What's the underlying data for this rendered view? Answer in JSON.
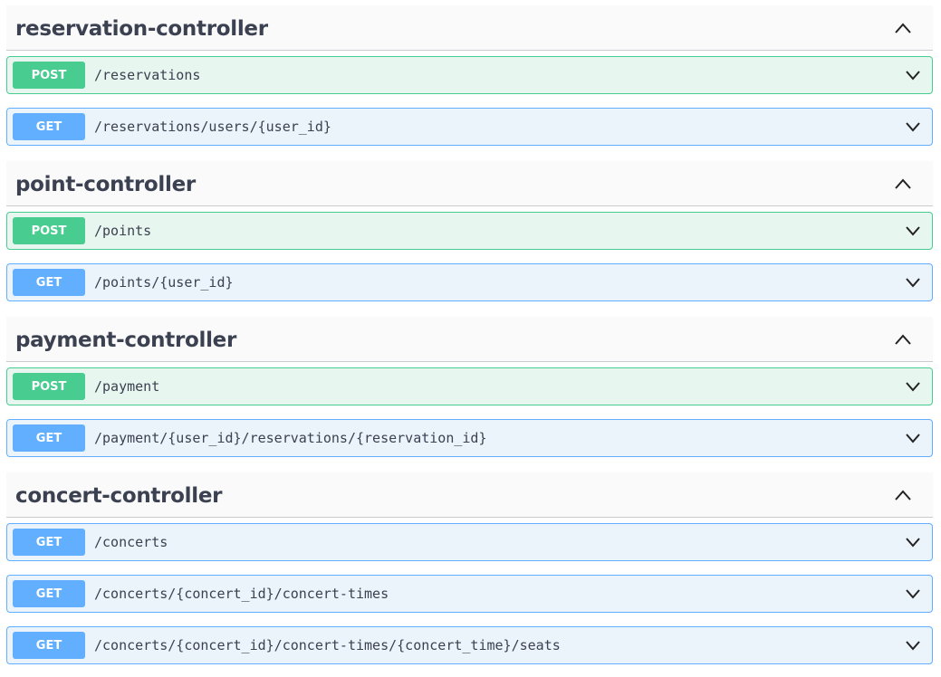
{
  "sections": [
    {
      "title": "reservation-controller",
      "operations": [
        {
          "method": "POST",
          "path": "/reservations"
        },
        {
          "method": "GET",
          "path": "/reservations/users/{user_id}"
        }
      ]
    },
    {
      "title": "point-controller",
      "operations": [
        {
          "method": "POST",
          "path": "/points"
        },
        {
          "method": "GET",
          "path": "/points/{user_id}"
        }
      ]
    },
    {
      "title": "payment-controller",
      "operations": [
        {
          "method": "POST",
          "path": "/payment"
        },
        {
          "method": "GET",
          "path": "/payment/{user_id}/reservations/{reservation_id}"
        }
      ]
    },
    {
      "title": "concert-controller",
      "operations": [
        {
          "method": "GET",
          "path": "/concerts"
        },
        {
          "method": "GET",
          "path": "/concerts/{concert_id}/concert-times"
        },
        {
          "method": "GET",
          "path": "/concerts/{concert_id}/concert-times/{concert_time}/seats"
        }
      ]
    }
  ],
  "icons": {
    "section_toggle": "chevron-up-icon",
    "operation_toggle": "chevron-down-icon"
  },
  "colors": {
    "post_accent": "#49cc90",
    "post_background": "#e8f6f0",
    "get_accent": "#61affe",
    "get_background": "#ebf3fb",
    "text": "#3b4151"
  }
}
